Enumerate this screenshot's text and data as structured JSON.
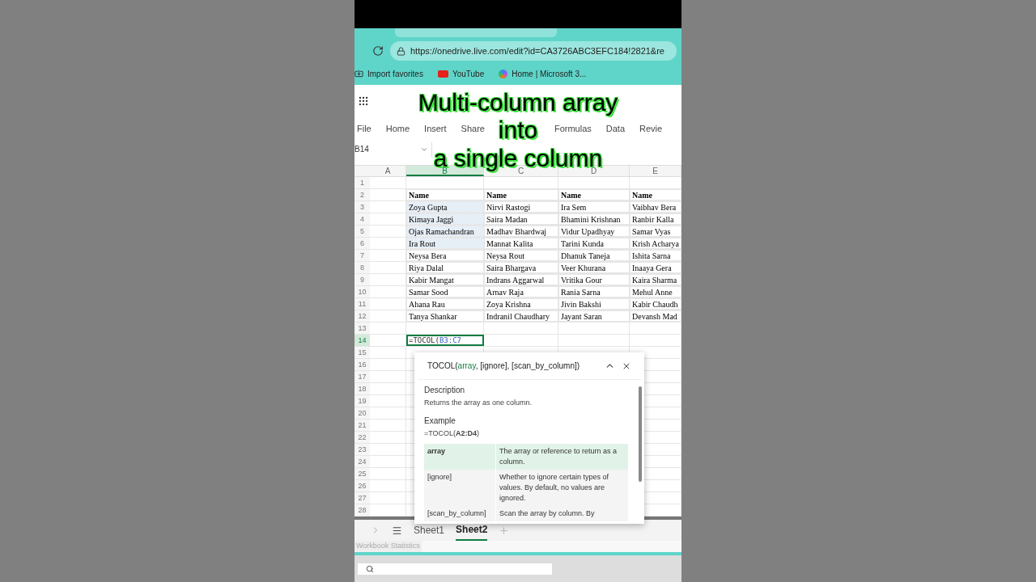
{
  "browser": {
    "url": "https://onedrive.live.com/edit?id=CA3726ABC3EFC184!2821&re",
    "bookmarks": [
      {
        "label": "Import favorites",
        "kind": "import"
      },
      {
        "label": "YouTube",
        "kind": "youtube"
      },
      {
        "label": "Home | Microsoft 3...",
        "kind": "microsoft"
      }
    ]
  },
  "caption": [
    "Multi-column array",
    "into",
    "a single column"
  ],
  "ribbon_tabs": [
    {
      "label": "File",
      "selected": false
    },
    {
      "label": "Home",
      "selected": false
    },
    {
      "label": "Insert",
      "selected": false
    },
    {
      "label": "Share",
      "selected": false
    },
    {
      "label": "Formulas",
      "selected": false
    },
    {
      "label": "Data",
      "selected": false
    },
    {
      "label": "Revie",
      "selected": false
    }
  ],
  "name_box": "B14",
  "columns": [
    {
      "label": "A",
      "selected": false
    },
    {
      "label": "B",
      "selected": true
    },
    {
      "label": "C",
      "selected": false
    },
    {
      "label": "D",
      "selected": false
    },
    {
      "label": "E",
      "selected": false
    }
  ],
  "row_numbers": [
    "1",
    "2",
    "3",
    "4",
    "5",
    "6",
    "7",
    "8",
    "9",
    "10",
    "11",
    "12",
    "13",
    "14",
    "15",
    "16",
    "17",
    "18",
    "19",
    "20",
    "21",
    "22",
    "23",
    "24",
    "25",
    "26",
    "27",
    "28"
  ],
  "header_cells": [
    "Name",
    "Name",
    "Name",
    "Name"
  ],
  "rows": [
    {
      "cells": [
        {
          "text": "Zoya Gupta",
          "selected": true
        },
        {
          "text": "Nirvi Rastogi",
          "selected": false
        },
        {
          "text": "Ira Sem",
          "selected": false
        },
        {
          "text": "Vaibhav Bera",
          "selected": false
        }
      ]
    },
    {
      "cells": [
        {
          "text": "Kimaya Jaggi",
          "selected": true
        },
        {
          "text": "Saira Madan",
          "selected": false
        },
        {
          "text": "Bhamini Krishnan",
          "selected": false
        },
        {
          "text": "Ranbir Kalla",
          "selected": false
        }
      ]
    },
    {
      "cells": [
        {
          "text": "Ojas Ramachandran",
          "selected": true
        },
        {
          "text": "Madhav Bhardwaj",
          "selected": false
        },
        {
          "text": "Vidur Upadhyay",
          "selected": false
        },
        {
          "text": "Samar Vyas",
          "selected": false
        }
      ]
    },
    {
      "cells": [
        {
          "text": "Ira Rout",
          "selected": true
        },
        {
          "text": "Mannat Kalita",
          "selected": false
        },
        {
          "text": "Tarini Kunda",
          "selected": false
        },
        {
          "text": "Krish Acharya",
          "selected": false
        }
      ]
    },
    {
      "cells": [
        {
          "text": "Neysa Bera",
          "selected": false
        },
        {
          "text": "Neysa Rout",
          "selected": false
        },
        {
          "text": "Dhanuk Taneja",
          "selected": false
        },
        {
          "text": "Ishita Sarna",
          "selected": false
        }
      ]
    },
    {
      "cells": [
        {
          "text": "Riya Dalal",
          "selected": false
        },
        {
          "text": "Saira Bhargava",
          "selected": false
        },
        {
          "text": "Veer Khurana",
          "selected": false
        },
        {
          "text": "Inaaya  Gera",
          "selected": false
        }
      ]
    },
    {
      "cells": [
        {
          "text": "Kabir Mangat",
          "selected": false
        },
        {
          "text": "Indrans Aggarwal",
          "selected": false
        },
        {
          "text": "Vritika Gour",
          "selected": false
        },
        {
          "text": "Kaira Sharma",
          "selected": false
        }
      ]
    },
    {
      "cells": [
        {
          "text": "Samar Sood",
          "selected": false
        },
        {
          "text": "Arnav Raja",
          "selected": false
        },
        {
          "text": "Rania Sarna",
          "selected": false
        },
        {
          "text": "Mehul Anne",
          "selected": false
        }
      ]
    },
    {
      "cells": [
        {
          "text": "Ahana  Rau",
          "selected": false
        },
        {
          "text": "Zoya Krishna",
          "selected": false
        },
        {
          "text": "Jivin Bakshi",
          "selected": false
        },
        {
          "text": "Kabir Chaudh",
          "selected": false
        }
      ]
    },
    {
      "cells": [
        {
          "text": "Tanya Shankar",
          "selected": false
        },
        {
          "text": "Indranil Chaudhary",
          "selected": false
        },
        {
          "text": "Jayant Saran",
          "selected": false
        },
        {
          "text": "Devansh Mad",
          "selected": false
        }
      ]
    }
  ],
  "edit_cell": {
    "prefix": "=TOCOL(",
    "reference": "B3:C7"
  },
  "tooltip": {
    "signature": [
      {
        "text": "TOCOL(",
        "selected": false
      },
      {
        "text": "array",
        "selected": true
      },
      {
        "text": ", [ignore], [scan_by_column])",
        "selected": false
      }
    ],
    "description_heading": "Description",
    "description": "Returns the array as one column.",
    "example_heading": "Example",
    "example": "=TOCOL(**A2:D4**)",
    "params": [
      {
        "name": "array",
        "text": "The array or reference to return as a column.",
        "selected": true
      },
      {
        "name": "[ignore]",
        "text": "Whether to ignore certain types of values. By default, no values are ignored.",
        "selected": false
      },
      {
        "name": "[scan_by_column]",
        "text": "Scan the array by column. By",
        "selected": false
      }
    ]
  },
  "sheet_tabs": [
    {
      "label": "Sheet1",
      "selected": false
    },
    {
      "label": "Sheet2",
      "selected": true
    }
  ],
  "status_bar": "Workbook Statistics"
}
